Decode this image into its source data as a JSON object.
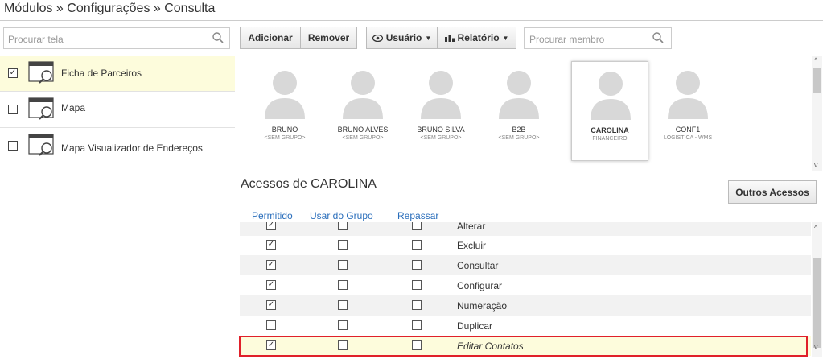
{
  "breadcrumb": "Módulos » Configurações » Consulta",
  "screen_search": {
    "placeholder": "Procurar tela"
  },
  "screens": [
    {
      "label": "Ficha de Parceiros",
      "checked": true
    },
    {
      "label": "Mapa",
      "checked": false
    },
    {
      "label": "Mapa Visualizador de Endereços",
      "checked": false
    }
  ],
  "toolbar": {
    "add": "Adicionar",
    "remove": "Remover",
    "user": "Usuário",
    "report": "Relatório",
    "member_search_placeholder": "Procurar membro"
  },
  "users": [
    {
      "name": "BRUNO",
      "group": "<SEM GRUPO>"
    },
    {
      "name": "BRUNO ALVES",
      "group": "<SEM GRUPO>"
    },
    {
      "name": "BRUNO SILVA",
      "group": "<SEM GRUPO>"
    },
    {
      "name": "B2B",
      "group": "<SEM GRUPO>"
    },
    {
      "name": "CAROLINA",
      "group": "FINANCEIRO",
      "selected": true
    },
    {
      "name": "CONF1",
      "group": "LOGISTICA - WMS"
    }
  ],
  "access": {
    "title": "Acessos de CAROLINA",
    "other_button": "Outros Acessos",
    "columns": [
      "Permitido",
      "Usar do Grupo",
      "Repassar"
    ],
    "rows": [
      {
        "name": "Alterar",
        "permitido": true,
        "usar_grupo": false,
        "repassar": false
      },
      {
        "name": "Excluir",
        "permitido": true,
        "usar_grupo": false,
        "repassar": false
      },
      {
        "name": "Consultar",
        "permitido": true,
        "usar_grupo": false,
        "repassar": false
      },
      {
        "name": "Configurar",
        "permitido": true,
        "usar_grupo": false,
        "repassar": false
      },
      {
        "name": "Numeração",
        "permitido": true,
        "usar_grupo": false,
        "repassar": false
      },
      {
        "name": "Duplicar",
        "permitido": false,
        "usar_grupo": false,
        "repassar": false
      },
      {
        "name": "Editar Contatos",
        "permitido": true,
        "usar_grupo": false,
        "repassar": false,
        "highlighted": true
      }
    ]
  },
  "colors": {
    "link_blue": "#2a6ebb",
    "selected_bg": "#fdfcdc",
    "highlight_border": "#e0202a"
  }
}
